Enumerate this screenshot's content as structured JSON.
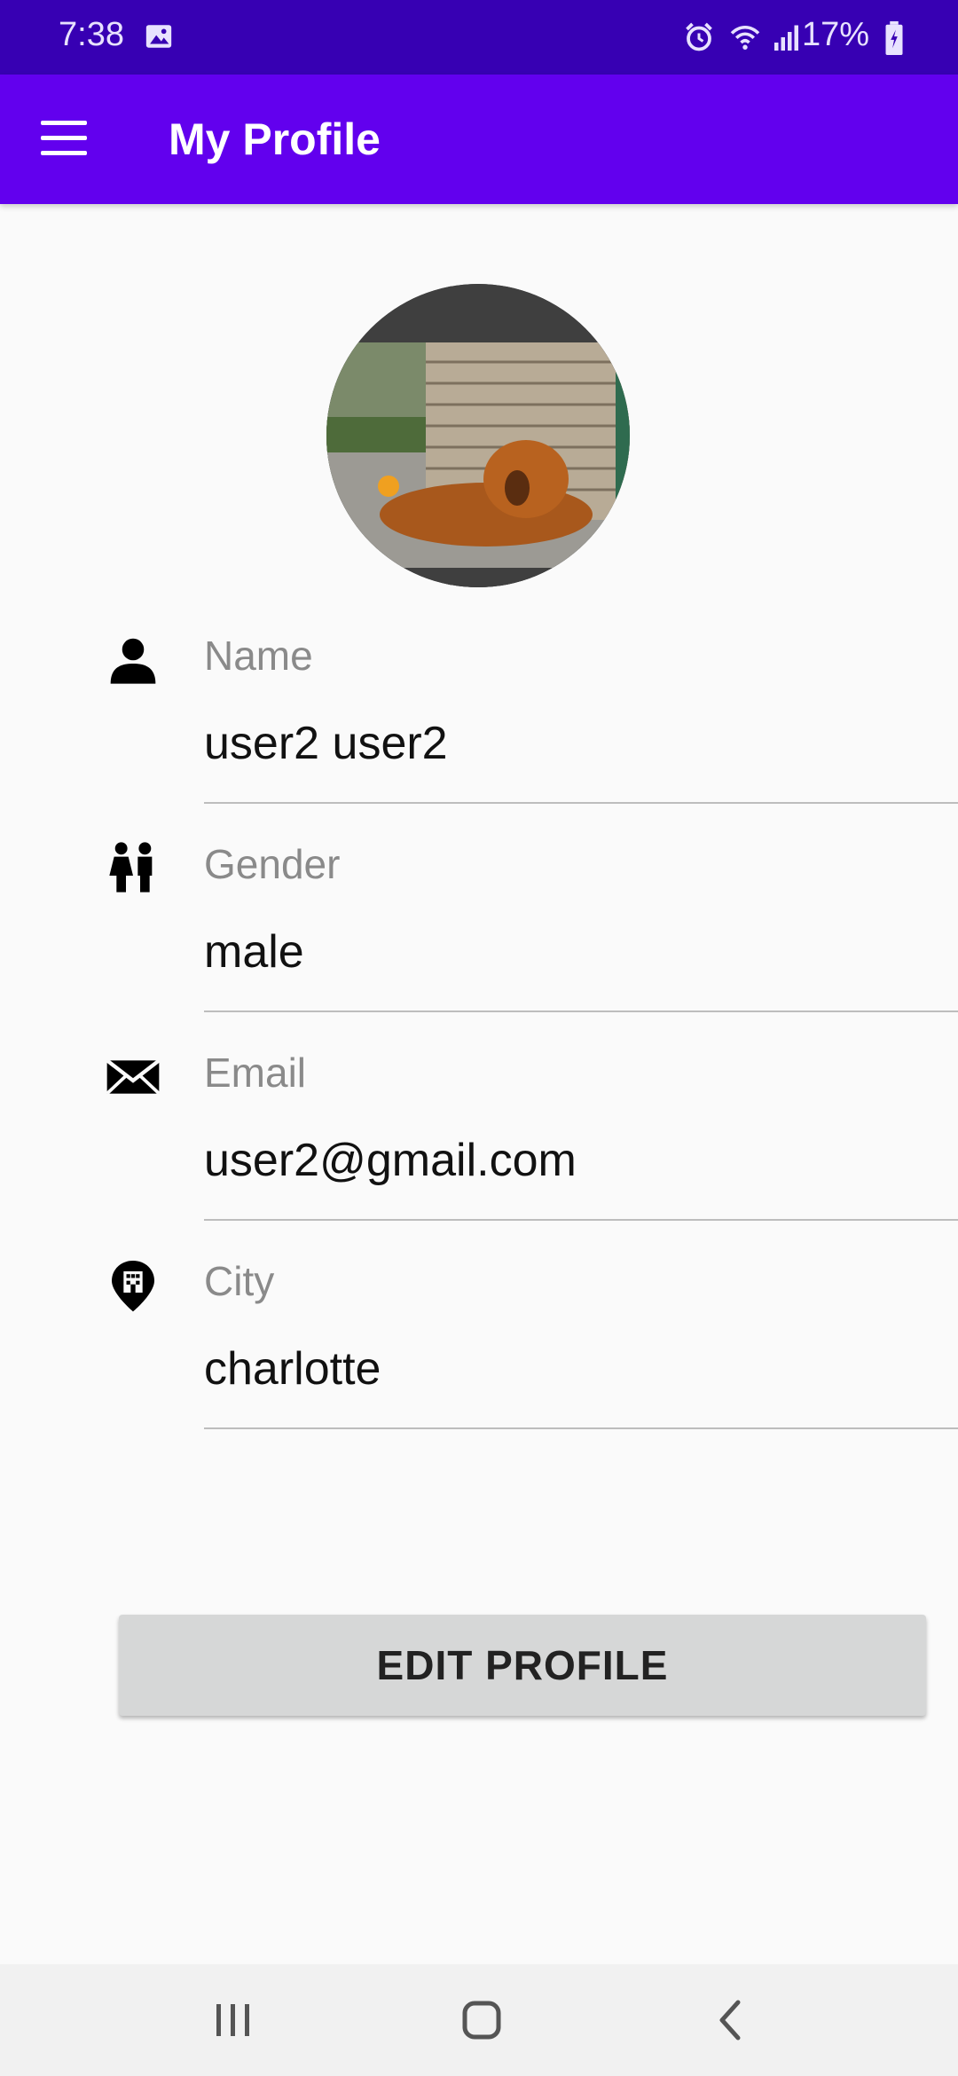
{
  "status_bar": {
    "time": "7:38",
    "battery": "17%"
  },
  "app_bar": {
    "title": "My Profile"
  },
  "profile": {
    "fields": [
      {
        "label": "Name",
        "value": "user2 user2",
        "icon": "person-icon"
      },
      {
        "label": "Gender",
        "value": "male",
        "icon": "gender-icon"
      },
      {
        "label": "Email",
        "value": "user2@gmail.com",
        "icon": "email-icon"
      },
      {
        "label": "City",
        "value": "charlotte",
        "icon": "city-location-icon"
      }
    ],
    "edit_button_label": "EDIT PROFILE"
  },
  "colors": {
    "status_bar": "#3700b3",
    "app_bar": "#6200ee",
    "button": "#d6d7d7"
  }
}
